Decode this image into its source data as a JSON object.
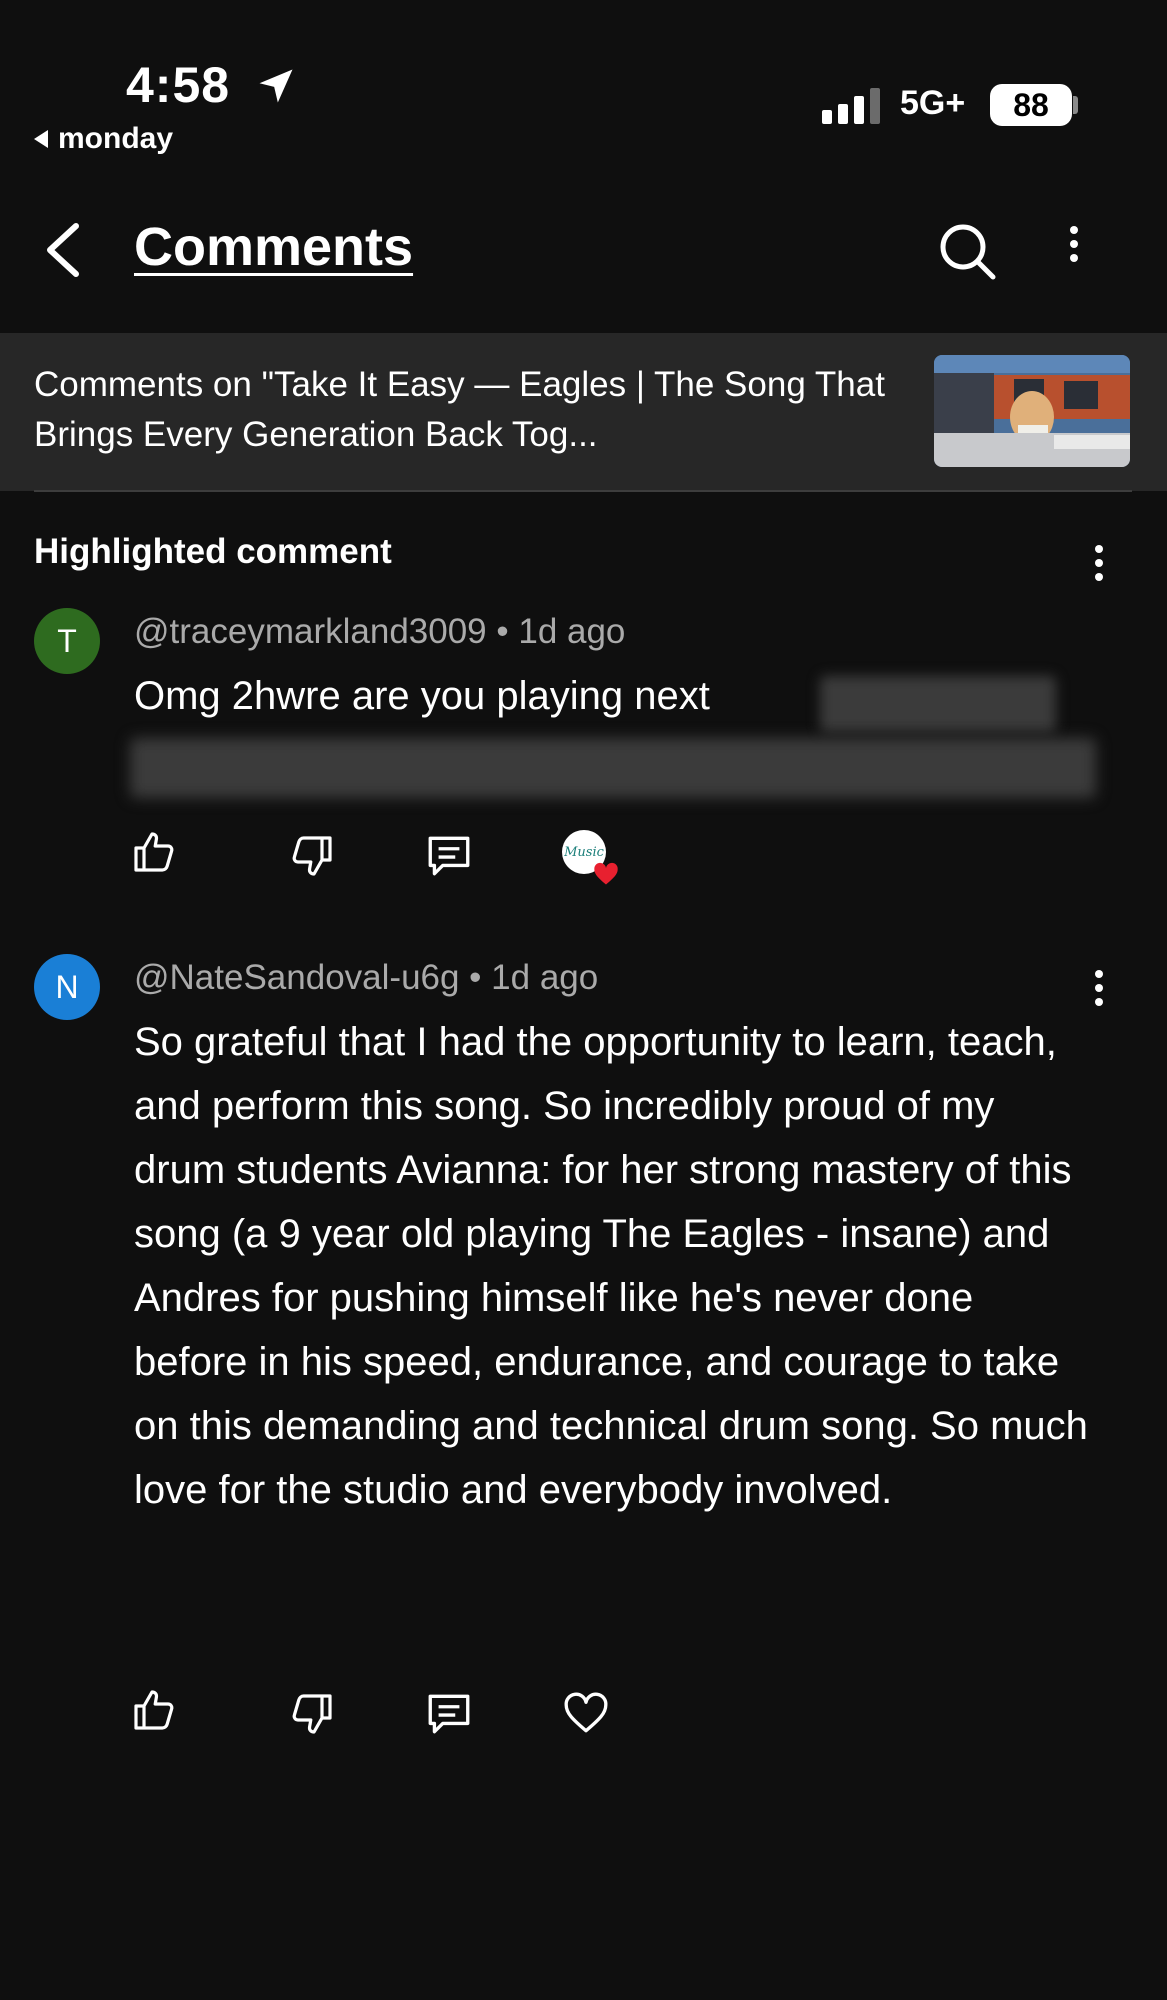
{
  "status_bar": {
    "time": "4:58",
    "back_app": "monday",
    "network": "5G+",
    "battery": "88"
  },
  "header": {
    "title": "Comments"
  },
  "video_banner": {
    "text": "Comments on \"Take It Easy — Eagles | The Song That Brings Every Generation Back Tog..."
  },
  "highlighted": {
    "label": "Highlighted comment",
    "comment": {
      "avatar_letter": "T",
      "avatar_color": "#2e6b1f",
      "meta": "@traceymarkland3009 • 1d ago",
      "text": "Omg 2hwre are you playing next"
    }
  },
  "comments": [
    {
      "avatar_letter": "N",
      "avatar_color": "#1a7fd6",
      "meta": "@NateSandoval-u6g • 1d ago",
      "text": "So grateful that I had the opportunity to learn, teach, and perform this song. So incredibly proud of my drum students Avianna: for her strong mastery of this song (a 9 year old playing The Eagles - insane) and Andres for pushing himself like he's never done before in his speed, endurance, and courage to take on this demanding and technical drum song. So much love for the studio and everybody involved."
    }
  ],
  "colors": {
    "background": "#0f0f0f",
    "banner": "#272727",
    "meta_text": "#aaaaaa",
    "heart_red": "#e8202f"
  }
}
